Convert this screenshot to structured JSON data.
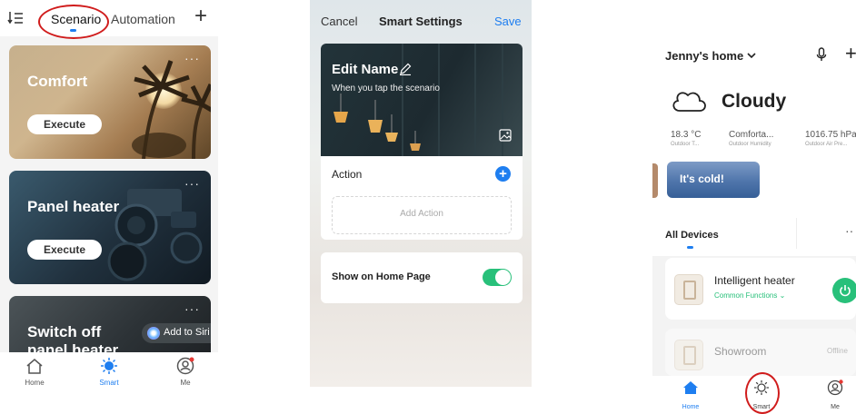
{
  "scenario_screen": {
    "tabs": [
      "Scenario",
      "Automation"
    ],
    "cards": [
      {
        "title": "Comfort",
        "execute_label": "Execute"
      },
      {
        "title": "Panel heater",
        "execute_label": "Execute"
      },
      {
        "title_line1": "Switch off",
        "title_line2": "panel heater",
        "siri_label": "Add to Siri"
      }
    ],
    "more_glyph": "···",
    "tabbar": [
      "Home",
      "Smart",
      "Me"
    ]
  },
  "smart_settings": {
    "cancel": "Cancel",
    "title": "Smart Settings",
    "save": "Save",
    "edit_name": "Edit Name",
    "hint": "When you tap the  scenario",
    "action_label": "Action",
    "add_action": "Add Action",
    "show_home": "Show on Home Page",
    "toggle_on": true
  },
  "home_screen": {
    "home_title": "Jenny's home",
    "weather": "Cloudy",
    "stats": [
      {
        "value": "18.3 °C",
        "label": "Outdoor T..."
      },
      {
        "value": "Comforta...",
        "label": "Outdoor Humidity"
      },
      {
        "value": "1016.75 hPa",
        "label": "Outdoor Air Pre..."
      }
    ],
    "banner": "It's cold!",
    "all_devices": "All Devices",
    "devices": [
      {
        "name": "Intelligent heater",
        "sub": "Common Functions"
      },
      {
        "name": "Showroom",
        "status": "Offline"
      }
    ],
    "tabbar": [
      "Home",
      "Smart",
      "Me"
    ]
  },
  "colors": {
    "accent": "#1e7ef0",
    "green": "#28c07a",
    "annotation": "#d01c1c"
  }
}
